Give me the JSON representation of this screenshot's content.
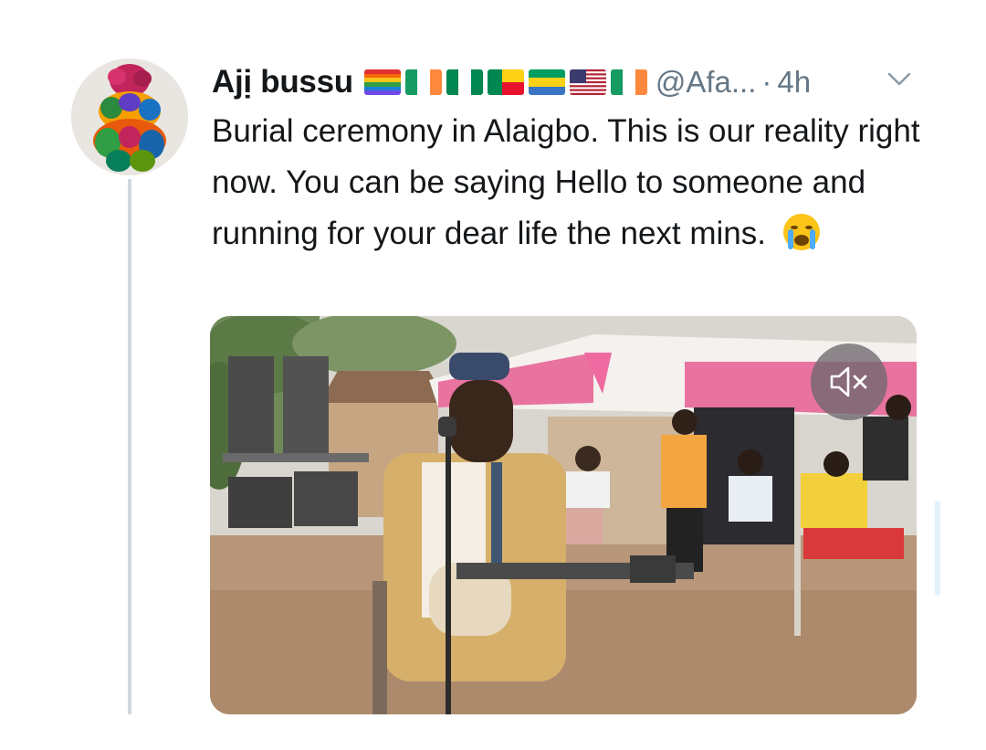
{
  "tweet": {
    "display_name": "Ajị bussu",
    "flags": [
      "rainbow-flag",
      "ireland-flag",
      "nigeria-flag",
      "benin-flag",
      "gabon-flag",
      "usa-flag",
      "ireland-flag"
    ],
    "handle": "@Afa...",
    "separator": "·",
    "time": "4h",
    "text": "Burial ceremony in Alaigbo. This is our reality right now. You can be saying Hello to someone and running for your dear life the next mins.",
    "emoji": "loudly-crying-face-icon",
    "media": {
      "type": "video",
      "mute_icon": "speaker-muted-icon"
    }
  },
  "colors": {
    "text": "#14171a",
    "secondary_text": "#657786",
    "thread_line": "#cfd9de",
    "tent_pink": "#e8739e"
  }
}
